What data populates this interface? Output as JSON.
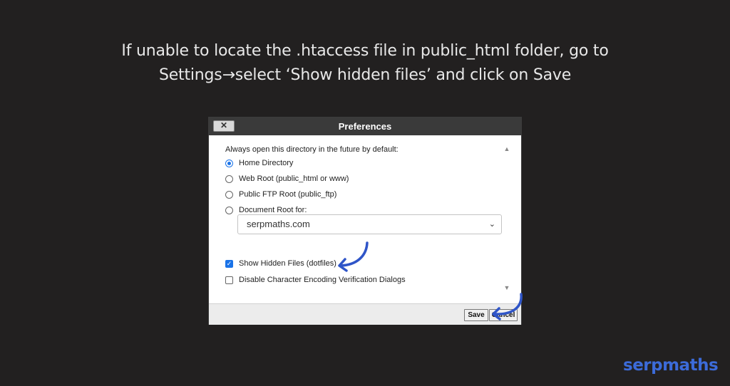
{
  "headline": {
    "line1": "If unable to locate the .htaccess file in public_html folder, go to",
    "line2": "Settings→select ‘Show hidden files’ and click on Save"
  },
  "dialog": {
    "close_label": "✕",
    "title": "Preferences",
    "prompt": "Always open this directory in the future by default:",
    "options": [
      {
        "label": "Home Directory",
        "selected": true
      },
      {
        "label": "Web Root (public_html or www)",
        "selected": false
      },
      {
        "label": "Public FTP Root (public_ftp)",
        "selected": false
      },
      {
        "label": "Document Root for:",
        "selected": false
      }
    ],
    "document_root_select": {
      "value": "serpmaths.com"
    },
    "checkboxes": [
      {
        "label": "Show Hidden Files (dotfiles)",
        "checked": true
      },
      {
        "label": "Disable Character Encoding Verification Dialogs",
        "checked": false
      }
    ],
    "buttons": {
      "save": "Save",
      "cancel": "Cancel"
    }
  },
  "logo": {
    "text": "serpmaths"
  },
  "colors": {
    "background": "#222020",
    "accent": "#1a73e8",
    "annotation_arrow": "#2f55c8",
    "logo": "#3c6bd9"
  }
}
